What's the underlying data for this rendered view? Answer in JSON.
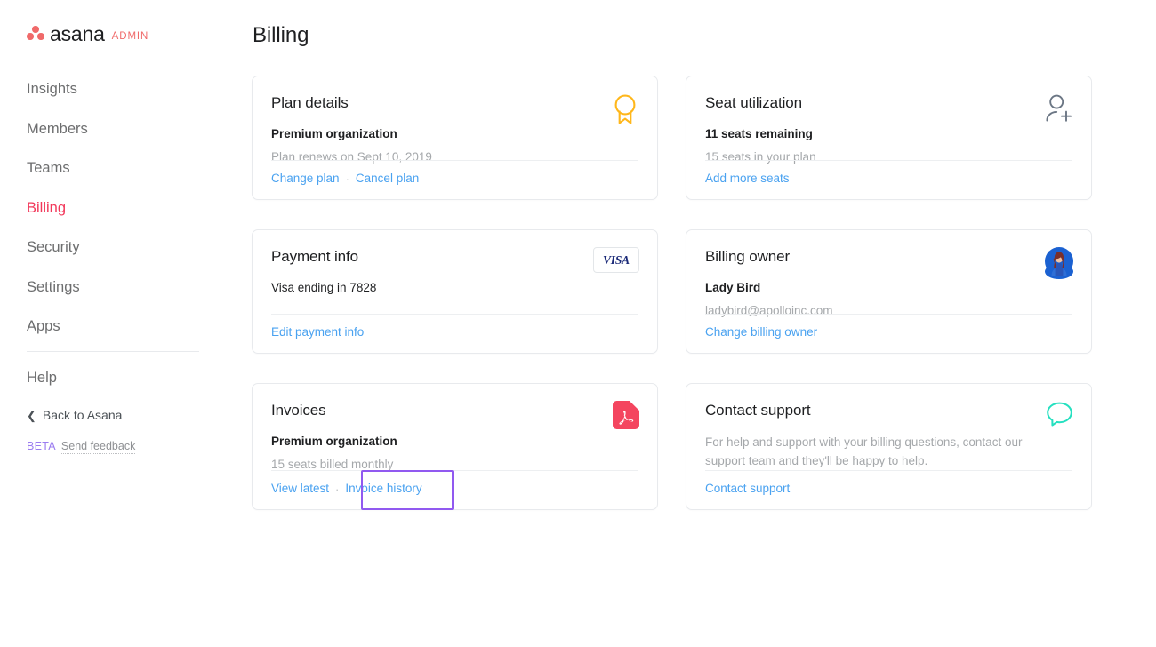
{
  "brand": {
    "logo_icon": "asana-dots-logo",
    "wordmark": "asana",
    "admin_label": "ADMIN"
  },
  "sidebar": {
    "items": [
      {
        "label": "Insights",
        "active": false
      },
      {
        "label": "Members",
        "active": false
      },
      {
        "label": "Teams",
        "active": false
      },
      {
        "label": "Billing",
        "active": true
      },
      {
        "label": "Security",
        "active": false
      },
      {
        "label": "Settings",
        "active": false
      },
      {
        "label": "Apps",
        "active": false
      }
    ],
    "help_label": "Help",
    "back_label": "Back to Asana",
    "back_icon": "chevron-left-icon",
    "beta_tag": "BETA",
    "feedback_label": "Send feedback",
    "active_color": "#f2385a",
    "text_color": "#6d6e6f",
    "beta_color": "#9b7cf0"
  },
  "header": {
    "title": "Billing"
  },
  "cards": {
    "plan_details": {
      "title": "Plan details",
      "primary": "Premium organization",
      "secondary": "Plan renews on Sept 10, 2019",
      "links": [
        "Change plan",
        "Cancel plan"
      ],
      "separator": "·",
      "icon": "award-ribbon-icon",
      "icon_color": "#ffb71b"
    },
    "seat_utilization": {
      "title": "Seat utilization",
      "primary": "11 seats remaining",
      "secondary": "15 seats in your plan",
      "links": [
        "Add more seats"
      ],
      "icon": "add-user-icon",
      "icon_color": "#6b7684"
    },
    "payment_info": {
      "title": "Payment info",
      "primary": "Visa ending in 7828",
      "secondary": "",
      "links": [
        "Edit payment info"
      ],
      "icon": "visa-card-badge",
      "badge_text": "VISA",
      "badge_color": "#1b2a78"
    },
    "billing_owner": {
      "title": "Billing owner",
      "primary": "Lady Bird",
      "secondary": "ladybird@apolloinc.com",
      "links": [
        "Change billing owner"
      ],
      "icon": "user-avatar",
      "avatar_bg": "#1b61d1"
    },
    "invoices": {
      "title": "Invoices",
      "primary": "Premium organization",
      "secondary": "15 seats billed monthly",
      "links": [
        "View latest",
        "Invoice history"
      ],
      "separator": "·",
      "icon": "pdf-file-icon",
      "icon_color": "#f4455f",
      "highlight": {
        "target": "Invoice history",
        "color": "#9159f0"
      }
    },
    "contact_support": {
      "title": "Contact support",
      "description": "For help and support with your billing questions, contact our support team and they'll be happy to help.",
      "links": [
        "Contact support"
      ],
      "icon": "chat-bubble-icon",
      "icon_color": "#25e0c0"
    }
  },
  "theme": {
    "link_color": "#4aa2f0",
    "card_border": "#e8eaed",
    "muted_text": "#a5a8ab",
    "body_text": "#1e1f21",
    "background": "#ffffff"
  }
}
